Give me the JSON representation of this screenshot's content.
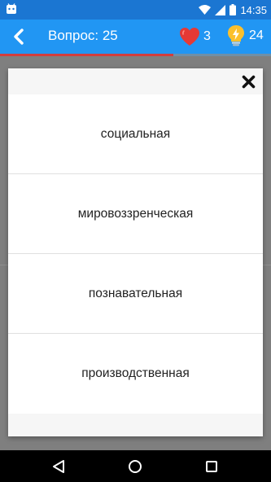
{
  "status_bar": {
    "time": "14:35",
    "icons": [
      "android-icon",
      "wifi-icon",
      "signal-icon",
      "battery-icon"
    ]
  },
  "app_bar": {
    "title": "Вопрос: 25",
    "lives_count": "3",
    "hints_count": "24",
    "icons": [
      "back-arrow-icon",
      "heart-icon",
      "lightbulb-icon"
    ]
  },
  "progress": {
    "fraction": 0.64
  },
  "dialog": {
    "close_icon": "close-icon",
    "options": [
      "социальная",
      "мировоззренческая",
      "познавательная",
      "производственная"
    ]
  },
  "nav_bar": {
    "icons": [
      "back-triangle-icon",
      "home-circle-icon",
      "recents-square-icon"
    ]
  },
  "colors": {
    "status_bar": "#1b76d2",
    "app_bar": "#2196f3",
    "progress": "#d33d3d",
    "heart": "#e53935",
    "bulb": "#fbc02d"
  }
}
